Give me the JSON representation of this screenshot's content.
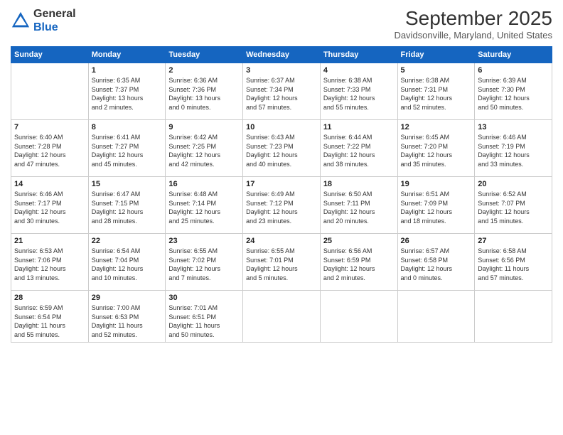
{
  "header": {
    "logo_general": "General",
    "logo_blue": "Blue",
    "month_title": "September 2025",
    "location": "Davidsonville, Maryland, United States"
  },
  "calendar": {
    "days_of_week": [
      "Sunday",
      "Monday",
      "Tuesday",
      "Wednesday",
      "Thursday",
      "Friday",
      "Saturday"
    ],
    "weeks": [
      [
        {
          "day": "",
          "info": ""
        },
        {
          "day": "1",
          "info": "Sunrise: 6:35 AM\nSunset: 7:37 PM\nDaylight: 13 hours\nand 2 minutes."
        },
        {
          "day": "2",
          "info": "Sunrise: 6:36 AM\nSunset: 7:36 PM\nDaylight: 13 hours\nand 0 minutes."
        },
        {
          "day": "3",
          "info": "Sunrise: 6:37 AM\nSunset: 7:34 PM\nDaylight: 12 hours\nand 57 minutes."
        },
        {
          "day": "4",
          "info": "Sunrise: 6:38 AM\nSunset: 7:33 PM\nDaylight: 12 hours\nand 55 minutes."
        },
        {
          "day": "5",
          "info": "Sunrise: 6:38 AM\nSunset: 7:31 PM\nDaylight: 12 hours\nand 52 minutes."
        },
        {
          "day": "6",
          "info": "Sunrise: 6:39 AM\nSunset: 7:30 PM\nDaylight: 12 hours\nand 50 minutes."
        }
      ],
      [
        {
          "day": "7",
          "info": "Sunrise: 6:40 AM\nSunset: 7:28 PM\nDaylight: 12 hours\nand 47 minutes."
        },
        {
          "day": "8",
          "info": "Sunrise: 6:41 AM\nSunset: 7:27 PM\nDaylight: 12 hours\nand 45 minutes."
        },
        {
          "day": "9",
          "info": "Sunrise: 6:42 AM\nSunset: 7:25 PM\nDaylight: 12 hours\nand 42 minutes."
        },
        {
          "day": "10",
          "info": "Sunrise: 6:43 AM\nSunset: 7:23 PM\nDaylight: 12 hours\nand 40 minutes."
        },
        {
          "day": "11",
          "info": "Sunrise: 6:44 AM\nSunset: 7:22 PM\nDaylight: 12 hours\nand 38 minutes."
        },
        {
          "day": "12",
          "info": "Sunrise: 6:45 AM\nSunset: 7:20 PM\nDaylight: 12 hours\nand 35 minutes."
        },
        {
          "day": "13",
          "info": "Sunrise: 6:46 AM\nSunset: 7:19 PM\nDaylight: 12 hours\nand 33 minutes."
        }
      ],
      [
        {
          "day": "14",
          "info": "Sunrise: 6:46 AM\nSunset: 7:17 PM\nDaylight: 12 hours\nand 30 minutes."
        },
        {
          "day": "15",
          "info": "Sunrise: 6:47 AM\nSunset: 7:15 PM\nDaylight: 12 hours\nand 28 minutes."
        },
        {
          "day": "16",
          "info": "Sunrise: 6:48 AM\nSunset: 7:14 PM\nDaylight: 12 hours\nand 25 minutes."
        },
        {
          "day": "17",
          "info": "Sunrise: 6:49 AM\nSunset: 7:12 PM\nDaylight: 12 hours\nand 23 minutes."
        },
        {
          "day": "18",
          "info": "Sunrise: 6:50 AM\nSunset: 7:11 PM\nDaylight: 12 hours\nand 20 minutes."
        },
        {
          "day": "19",
          "info": "Sunrise: 6:51 AM\nSunset: 7:09 PM\nDaylight: 12 hours\nand 18 minutes."
        },
        {
          "day": "20",
          "info": "Sunrise: 6:52 AM\nSunset: 7:07 PM\nDaylight: 12 hours\nand 15 minutes."
        }
      ],
      [
        {
          "day": "21",
          "info": "Sunrise: 6:53 AM\nSunset: 7:06 PM\nDaylight: 12 hours\nand 13 minutes."
        },
        {
          "day": "22",
          "info": "Sunrise: 6:54 AM\nSunset: 7:04 PM\nDaylight: 12 hours\nand 10 minutes."
        },
        {
          "day": "23",
          "info": "Sunrise: 6:55 AM\nSunset: 7:02 PM\nDaylight: 12 hours\nand 7 minutes."
        },
        {
          "day": "24",
          "info": "Sunrise: 6:55 AM\nSunset: 7:01 PM\nDaylight: 12 hours\nand 5 minutes."
        },
        {
          "day": "25",
          "info": "Sunrise: 6:56 AM\nSunset: 6:59 PM\nDaylight: 12 hours\nand 2 minutes."
        },
        {
          "day": "26",
          "info": "Sunrise: 6:57 AM\nSunset: 6:58 PM\nDaylight: 12 hours\nand 0 minutes."
        },
        {
          "day": "27",
          "info": "Sunrise: 6:58 AM\nSunset: 6:56 PM\nDaylight: 11 hours\nand 57 minutes."
        }
      ],
      [
        {
          "day": "28",
          "info": "Sunrise: 6:59 AM\nSunset: 6:54 PM\nDaylight: 11 hours\nand 55 minutes."
        },
        {
          "day": "29",
          "info": "Sunrise: 7:00 AM\nSunset: 6:53 PM\nDaylight: 11 hours\nand 52 minutes."
        },
        {
          "day": "30",
          "info": "Sunrise: 7:01 AM\nSunset: 6:51 PM\nDaylight: 11 hours\nand 50 minutes."
        },
        {
          "day": "",
          "info": ""
        },
        {
          "day": "",
          "info": ""
        },
        {
          "day": "",
          "info": ""
        },
        {
          "day": "",
          "info": ""
        }
      ]
    ]
  }
}
